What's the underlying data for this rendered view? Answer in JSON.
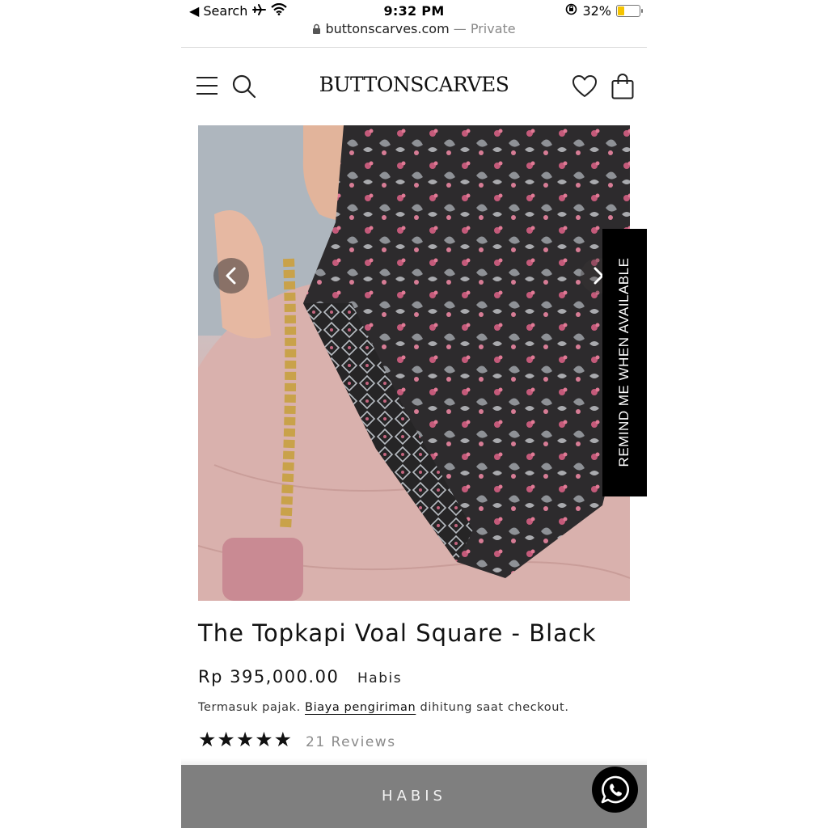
{
  "status_bar": {
    "back_label": "◀ Search",
    "time": "9:32 PM",
    "battery_percent": "32%",
    "battery_level": 0.32
  },
  "browser": {
    "domain": "buttonscarves.com",
    "privacy": "— Private"
  },
  "header": {
    "brand": "BUTTONSCARVES",
    "icons": [
      "menu-icon",
      "search-icon",
      "heart-icon",
      "bag-icon"
    ]
  },
  "product": {
    "title": "The Topkapi Voal Square - Black",
    "price": "Rp 395,000.00",
    "availability": "Habis",
    "tax_prefix": "Termasuk pajak.",
    "shipping_link": "Biaya pengiriman",
    "tax_suffix": "dihitung saat checkout.",
    "rating": 5,
    "rating_stars": "★★★★★",
    "reviews": "21 Reviews"
  },
  "remind_button": "REMIND ME WHEN AVAILABLE",
  "cta": {
    "label": "HABIS"
  },
  "colors": {
    "cta_bg": "#7f7f7f",
    "remind_bg": "#000000",
    "battery": "#f5c400"
  }
}
